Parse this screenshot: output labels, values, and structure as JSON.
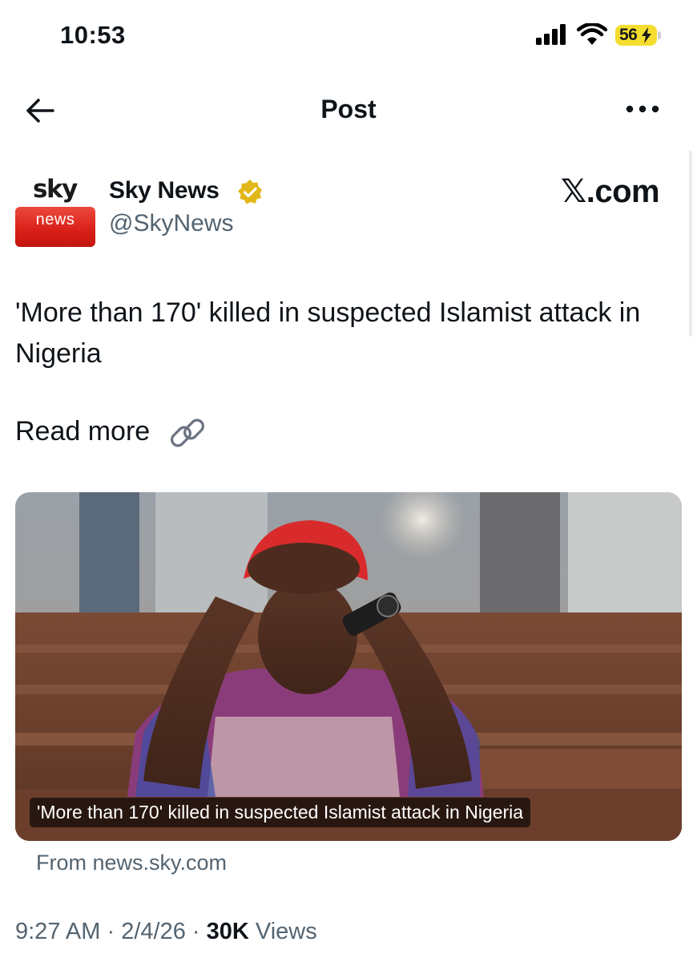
{
  "status_bar": {
    "time": "10:53",
    "battery": "56",
    "battery_color": "#f5dd2f",
    "icons": [
      "cellular-signal-icon",
      "wifi-icon",
      "battery-charging-icon"
    ]
  },
  "header": {
    "title": "Post",
    "back_icon": "arrow-left-icon",
    "more_icon": "more-horizontal-icon"
  },
  "author": {
    "avatar_top_text": "sky",
    "avatar_bottom_text": "news",
    "name": "Sky News",
    "handle": "@SkyNews",
    "verified_color": "#e2b719",
    "source_logo": "𝕏.com"
  },
  "post": {
    "text": "'More than 170' killed in suspected Islamist attack in Nigeria",
    "read_more": "Read more",
    "link_icon": "link-chain-icon"
  },
  "card": {
    "caption": "'More than 170' killed in suspected Islamist attack in Nigeria",
    "source": "From news.sky.com"
  },
  "meta": {
    "time": "9:27 AM",
    "separator": "·",
    "date": "2/4/26",
    "views_count": "30K",
    "views_label": "Views"
  }
}
